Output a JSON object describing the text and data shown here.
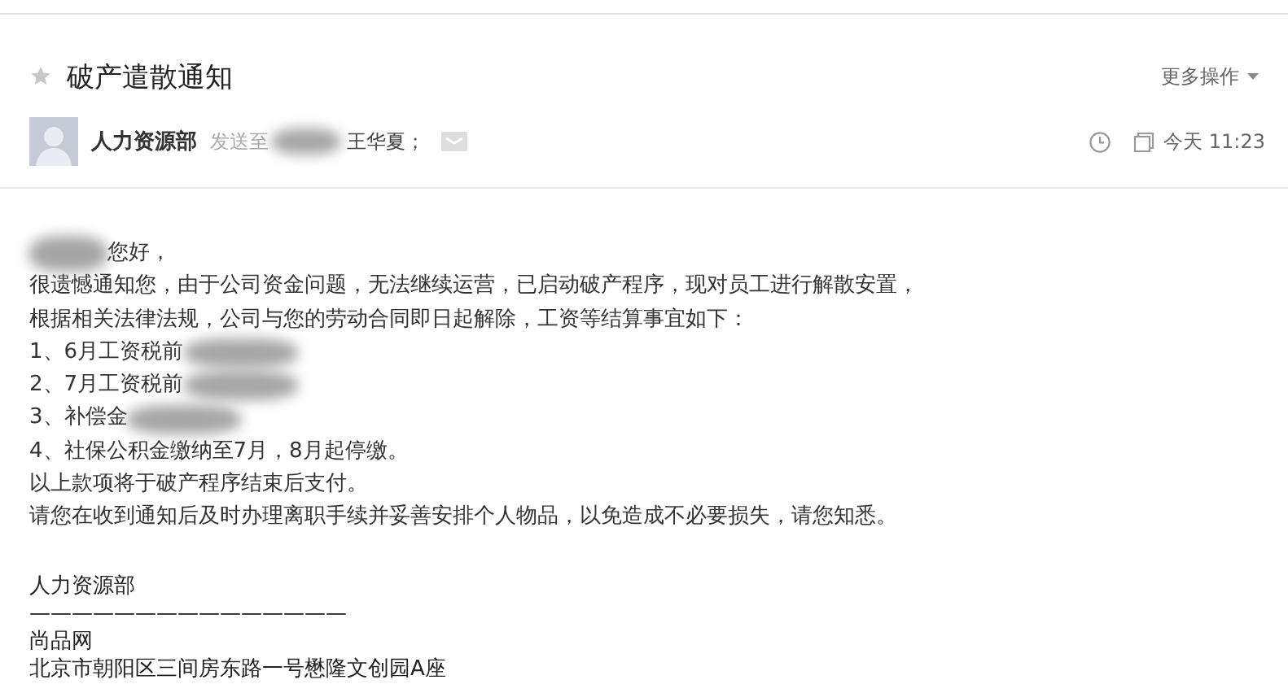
{
  "email": {
    "subject": "破产遣散通知",
    "starred": false,
    "more_actions": "更多操作",
    "sender": "人力资源部",
    "sent_to_label": "发送至",
    "recipients": [
      {
        "name": "王华夏；",
        "redacted_before": true
      }
    ],
    "time": "今天 11:23"
  },
  "body": [
    {
      "kind": "redacted-prefix",
      "text": "您好，"
    },
    {
      "kind": "plain",
      "text": "很遗憾通知您，由于公司资金问题，无法继续运营，已启动破产程序，现对员工进行解散安置，"
    },
    {
      "kind": "plain",
      "text": "根据相关法律法规，公司与您的劳动合同即日起解除，工资等结算事宜如下："
    },
    {
      "kind": "redacted-suffix",
      "text": "1、6月工资税前"
    },
    {
      "kind": "redacted-suffix",
      "text": "2、7月工资税前"
    },
    {
      "kind": "redacted-suffix",
      "text": "3、补偿金"
    },
    {
      "kind": "plain",
      "text": "4、社保公积金缴纳至7月，8月起停缴。"
    },
    {
      "kind": "plain",
      "text": "以上款项将于破产程序结束后支付。"
    },
    {
      "kind": "plain",
      "text": "请您在收到通知后及时办理离职手续并妥善安排个人物品，以免造成不必要损失，请您知悉。"
    }
  ],
  "signature": [
    "人力资源部",
    "———————————————",
    "尚品网",
    "北京市朝阳区三间房东路一号懋隆文创园A座"
  ]
}
